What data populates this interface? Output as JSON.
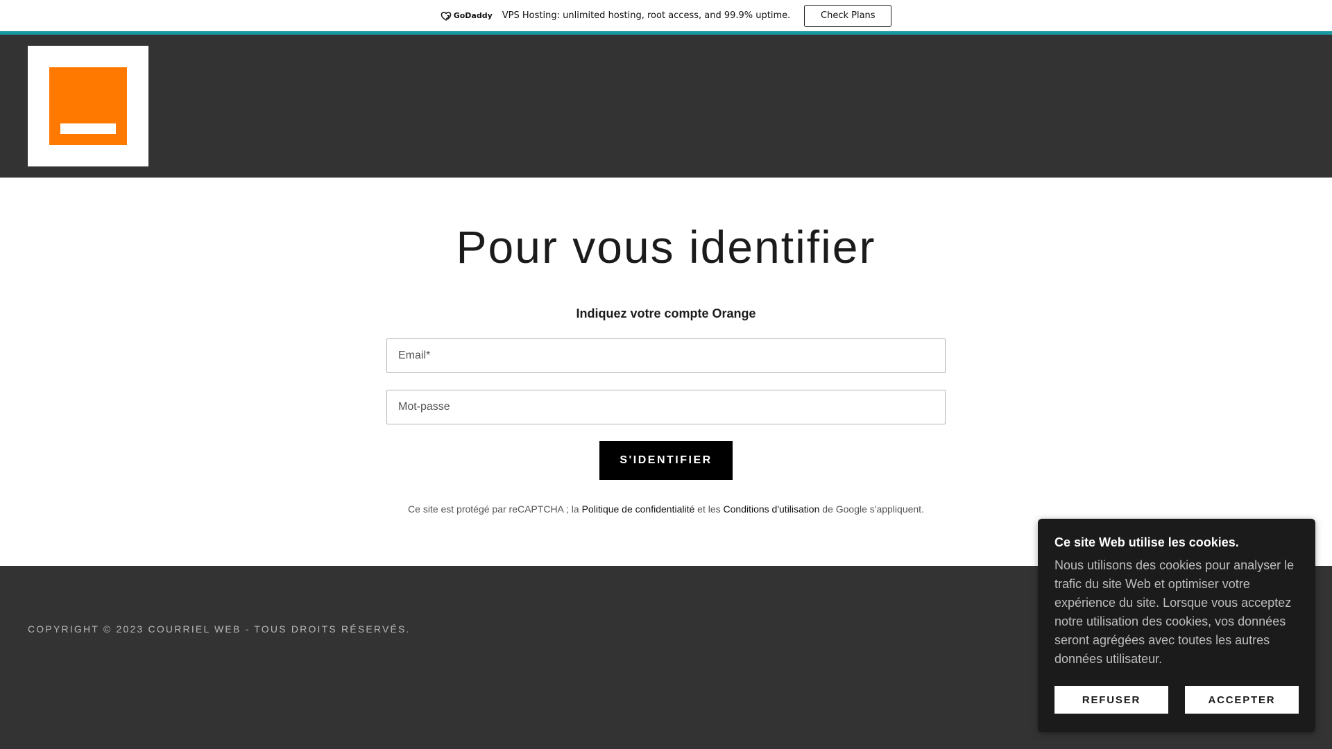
{
  "promo": {
    "brand": "GoDaddy",
    "brand_icon": "godaddy-logo-icon",
    "text": "VPS Hosting: unlimited hosting, root access, and 99.9% uptime.",
    "button": "Check Plans",
    "stripe_color": "#1a9aa0"
  },
  "header": {
    "background": "#333333",
    "logo": "orange-logo",
    "logo_color": "#ff7900"
  },
  "form": {
    "title": "Pour vous identifier",
    "subtitle": "Indiquez votre compte Orange",
    "email_placeholder": "Email*",
    "email_value": "",
    "password_placeholder": "Mot-passe",
    "password_value": "",
    "submit": "S'IDENTIFIER",
    "legal_prefix": "Ce site est protégé par reCAPTCHA ; la ",
    "legal_privacy": "Politique de confidentialité",
    "legal_mid": " et les ",
    "legal_terms": "Conditions d'utilisation",
    "legal_suffix": " de Google s'appliquent."
  },
  "footer": {
    "copyright": "COPYRIGHT © 2023 COURRIEL WEB - TOUS DROITS RÉSERVÉS."
  },
  "cookie": {
    "title": "Ce site Web utilise les cookies.",
    "text": "Nous utilisons des cookies pour analyser le trafic du site Web et optimiser votre expérience du site. Lorsque vous acceptez notre utilisation des cookies, vos données seront agrégées avec toutes les autres données utilisateur.",
    "refuse": "REFUSER",
    "accept": "ACCEPTER"
  }
}
